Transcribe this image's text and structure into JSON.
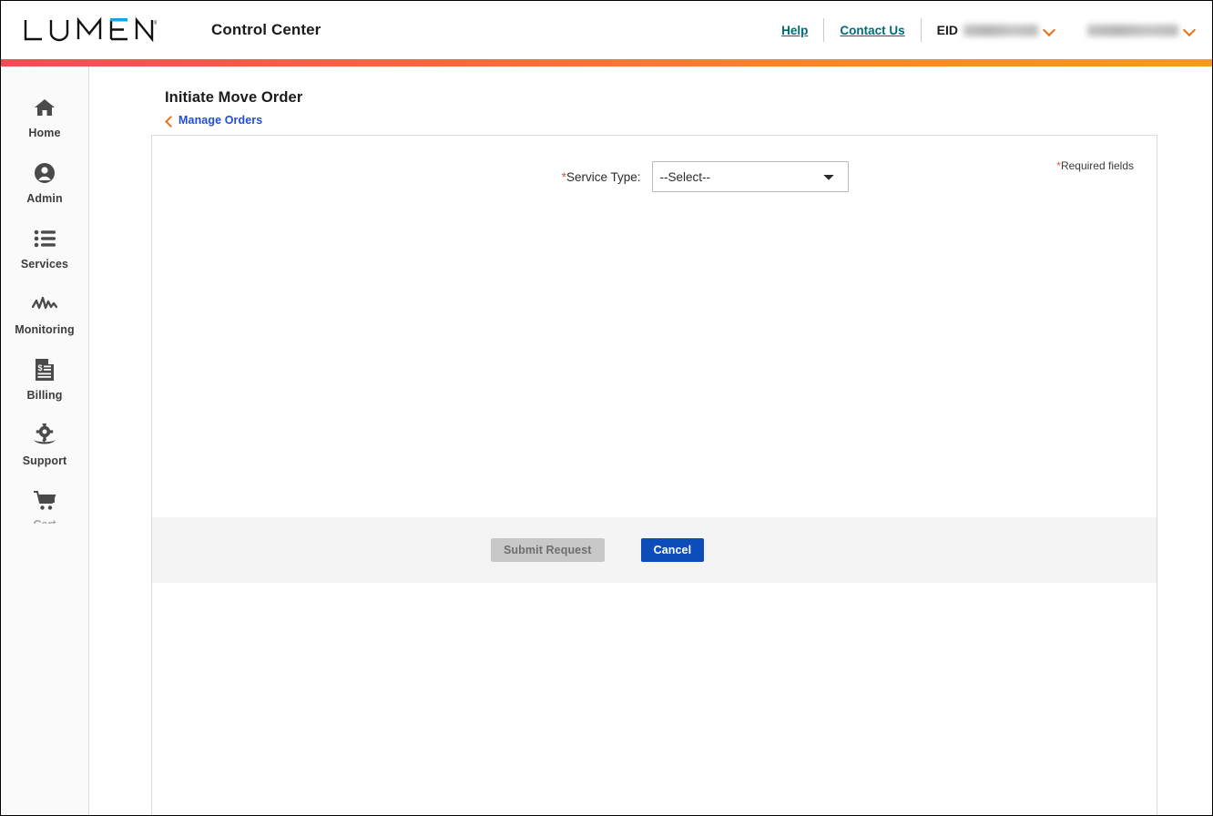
{
  "header": {
    "logo_text": "LUMEN",
    "logo_registered": "®",
    "app_title": "Control Center",
    "help_label": "Help",
    "contact_label": "Contact Us",
    "eid_label": "EID",
    "eid_value_masked": "",
    "account_value_masked": "",
    "accent_gradient_start": "#ef4d56",
    "accent_gradient_end": "#f59a21",
    "link_color": "#04697a",
    "chevron_color": "#e8701a"
  },
  "sidebar": {
    "items": [
      {
        "label": "Home",
        "icon": "home-icon"
      },
      {
        "label": "Admin",
        "icon": "user-circle-icon"
      },
      {
        "label": "Services",
        "icon": "list-icon"
      },
      {
        "label": "Monitoring",
        "icon": "activity-icon"
      },
      {
        "label": "Billing",
        "icon": "invoice-icon"
      },
      {
        "label": "Support",
        "icon": "gear-hand-icon"
      }
    ],
    "cart": {
      "label": "Cart",
      "icon": "shopping-cart-icon"
    }
  },
  "page": {
    "title": "Initiate Move Order",
    "breadcrumb_label": "Manage Orders",
    "breadcrumb_icon": "chevron-left-icon"
  },
  "form": {
    "required_note_star": "*",
    "required_note_text": "Required fields",
    "service_type": {
      "star": "*",
      "label": "Service Type:",
      "selected": "--Select--",
      "options": [
        "--Select--"
      ]
    }
  },
  "actions": {
    "submit_label": "Submit Request",
    "submit_disabled": true,
    "cancel_label": "Cancel",
    "cancel_color": "#0d4dba"
  }
}
